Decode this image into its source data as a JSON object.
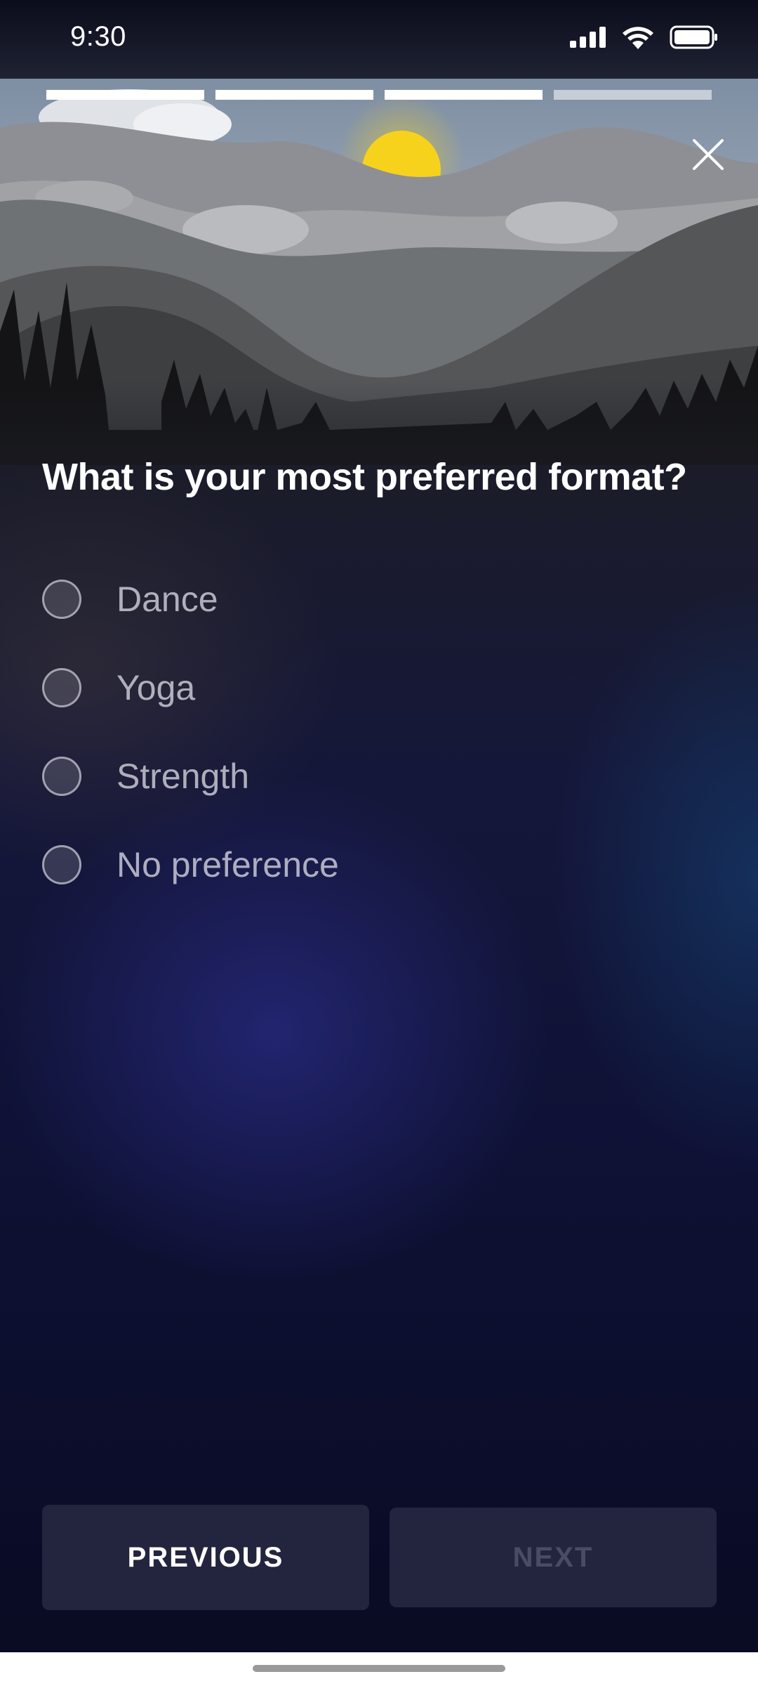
{
  "status_bar": {
    "time": "9:30",
    "icons": [
      "signal-icon",
      "wifi-icon",
      "battery-icon"
    ]
  },
  "progress": {
    "total_steps": 4,
    "completed_steps": 3
  },
  "header": {
    "close_icon": "close-icon"
  },
  "question": {
    "title": "What is your most preferred format?",
    "options": [
      {
        "label": "Dance",
        "selected": false
      },
      {
        "label": "Yoga",
        "selected": false
      },
      {
        "label": "Strength",
        "selected": false
      },
      {
        "label": "No preference",
        "selected": false
      }
    ]
  },
  "footer": {
    "previous_label": "PREVIOUS",
    "next_label": "NEXT",
    "next_enabled": false
  },
  "colors": {
    "accent_sun": "#f7d21c",
    "button_bg": "#23253f",
    "background_dark": "#0c0f2e"
  }
}
